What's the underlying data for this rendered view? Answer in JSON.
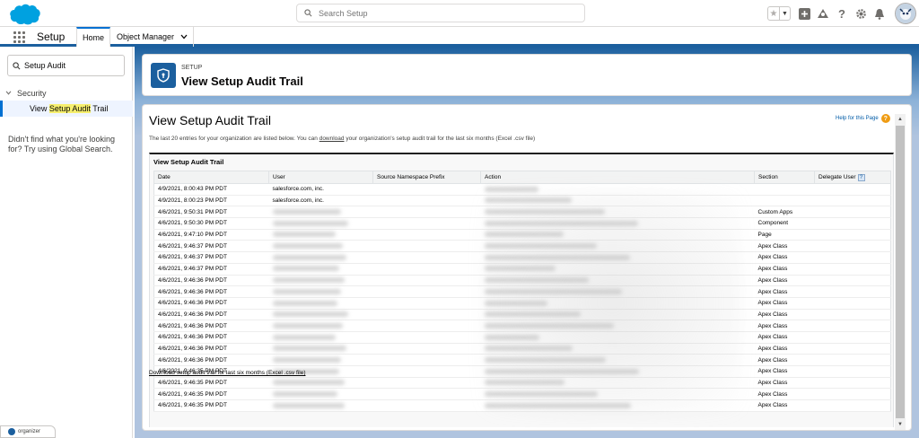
{
  "header": {
    "search_placeholder": "Search Setup"
  },
  "context": {
    "app_name": "Setup",
    "tabs": [
      {
        "label": "Home"
      },
      {
        "label": "Object Manager"
      }
    ]
  },
  "sidebar": {
    "quickfind_value": "Setup Audit",
    "tree_group": "Security",
    "tree_item_before": "View ",
    "tree_item_highlight": "Setup Audit",
    "tree_item_after": " Trail",
    "help_text": "Didn't find what you're looking for? Try using Global Search."
  },
  "page_header": {
    "eyebrow": "SETUP",
    "title": "View Setup Audit Trail"
  },
  "main": {
    "title": "View Setup Audit Trail",
    "help_link": "Help for this Page",
    "desc_before": "The last 20 entries for your organization are listed below. You can ",
    "desc_link": "download",
    "desc_after": " your organization's setup audit trail for the last six months (Excel .csv file)",
    "table_title": "View Setup Audit Trail",
    "columns": [
      "Date",
      "User",
      "Source Namespace Prefix",
      "Action",
      "Section",
      "Delegate User"
    ],
    "rows": [
      {
        "date": "4/9/2021, 8:00:43 PM PDT",
        "user": "salesforce.com, inc.",
        "section": ""
      },
      {
        "date": "4/9/2021, 8:00:23 PM PDT",
        "user": "salesforce.com, inc.",
        "section": ""
      },
      {
        "date": "4/6/2021, 9:50:31 PM PDT",
        "user": "",
        "section": "Custom Apps"
      },
      {
        "date": "4/6/2021, 9:50:30 PM PDT",
        "user": "",
        "section": "Component"
      },
      {
        "date": "4/6/2021, 9:47:10 PM PDT",
        "user": "",
        "section": "Page"
      },
      {
        "date": "4/6/2021, 9:46:37 PM PDT",
        "user": "",
        "section": "Apex Class"
      },
      {
        "date": "4/6/2021, 9:46:37 PM PDT",
        "user": "",
        "section": "Apex Class"
      },
      {
        "date": "4/6/2021, 9:46:37 PM PDT",
        "user": "",
        "section": "Apex Class"
      },
      {
        "date": "4/6/2021, 9:46:36 PM PDT",
        "user": "",
        "section": "Apex Class"
      },
      {
        "date": "4/6/2021, 9:46:36 PM PDT",
        "user": "",
        "section": "Apex Class"
      },
      {
        "date": "4/6/2021, 9:46:36 PM PDT",
        "user": "",
        "section": "Apex Class"
      },
      {
        "date": "4/6/2021, 9:46:36 PM PDT",
        "user": "",
        "section": "Apex Class"
      },
      {
        "date": "4/6/2021, 9:46:36 PM PDT",
        "user": "",
        "section": "Apex Class"
      },
      {
        "date": "4/6/2021, 9:46:36 PM PDT",
        "user": "",
        "section": "Apex Class"
      },
      {
        "date": "4/6/2021, 9:46:36 PM PDT",
        "user": "",
        "section": "Apex Class"
      },
      {
        "date": "4/6/2021, 9:46:36 PM PDT",
        "user": "",
        "section": "Apex Class"
      },
      {
        "date": "4/6/2021, 9:46:35 PM PDT",
        "user": "",
        "section": "Apex Class"
      },
      {
        "date": "4/6/2021, 9:46:35 PM PDT",
        "user": "",
        "section": "Apex Class"
      },
      {
        "date": "4/6/2021, 9:46:35 PM PDT",
        "user": "",
        "section": "Apex Class"
      },
      {
        "date": "4/6/2021, 9:46:35 PM PDT",
        "user": "",
        "section": "Apex Class"
      }
    ],
    "download_link": "Download setup audit trail for last six months (Excel .csv file)"
  },
  "organizer": {
    "label": "organizer"
  },
  "colors": {
    "brand_blue": "#1b5f9e",
    "link_blue": "#0070d2",
    "help_orange": "#ef9c13"
  }
}
